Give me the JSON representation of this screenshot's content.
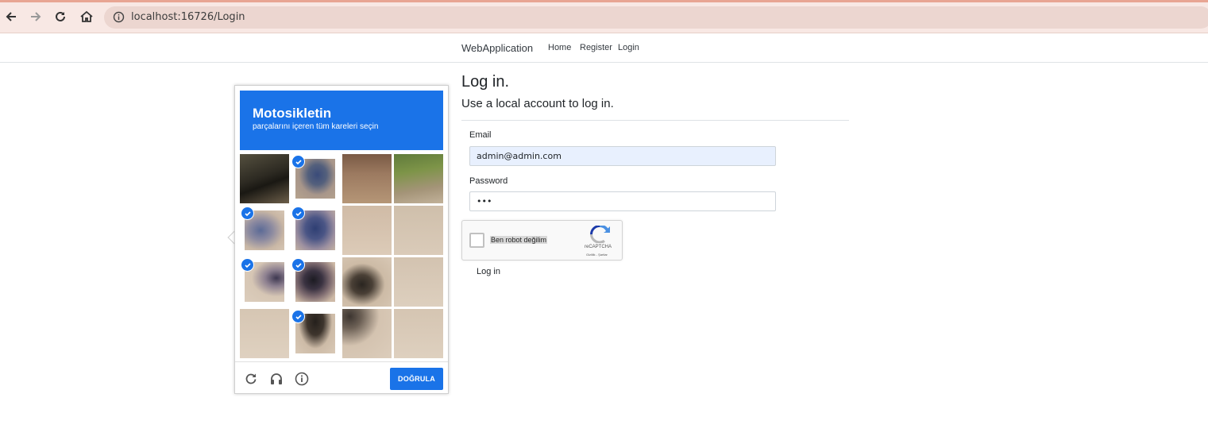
{
  "browser": {
    "url": "localhost:16726/Login"
  },
  "navbar": {
    "brand": "WebApplication",
    "links": [
      "Home",
      "Register",
      "Login"
    ]
  },
  "login": {
    "title": "Log in.",
    "subtitle": "Use a local account to log in.",
    "email_label": "Email",
    "email_value": "admin@admin.com",
    "password_label": "Password",
    "password_value": "•••",
    "submit_label": "Log in"
  },
  "recaptcha": {
    "checkbox_label": "Ben robot değilim",
    "brand": "reCAPTCHA",
    "terms": "Gizlilik - Şartlar"
  },
  "challenge": {
    "title": "Motosikletin",
    "subtitle": "parçalarını içeren tüm kareleri seçin",
    "verify_label": "DOĞRULA",
    "icons": [
      "reload-icon",
      "audio-icon",
      "info-icon"
    ],
    "selected_tiles": [
      1,
      4,
      5,
      8,
      9,
      13
    ]
  },
  "colors": {
    "accent": "#1a73e8",
    "browser_bar": "#f8e8e4",
    "email_autofill": "#e8f0fe"
  }
}
